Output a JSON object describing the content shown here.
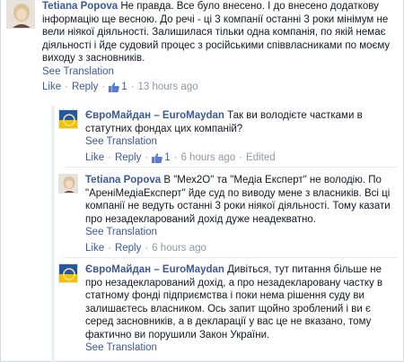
{
  "comments": [
    {
      "author": "Tetiana Popova",
      "text": "Не правда. Все було внесено. І до внесено додаткову інформацію ще весною. До речі - ці 3 компанії останні 3 роки мінімум не вели ніякої діяльності. Залишилася тільки одна компанія, по якій немає діяльності і йде судовий процес з російськими співвласниками по моєму виходу з засновників.",
      "see_translation": "See Translation",
      "actions": {
        "like": "Like",
        "reply": "Reply",
        "likes": "1",
        "time": "13 hours ago",
        "edited": ""
      }
    },
    {
      "author": "ЄвроМайдан – EuroMaydan",
      "text": "Так ви володієте частками в статутних фондах цих компаній?",
      "see_translation": "See Translation",
      "actions": {
        "like": "Like",
        "reply": "Reply",
        "likes": "1",
        "time": "6 hours ago",
        "edited": "Edited"
      }
    },
    {
      "author": "Tetiana Popova",
      "text": "В \"Мех2О\" та \"Медіа Експерт\" не володію. По \"АреніМедіаЕксперт\" йде суд по виводу мене з власників. Всі ці компанії не ведуть останні 3 роки ніякої діяльності. Тому казати про незадекларований дохід дуже неадекватно.",
      "see_translation": "See Translation",
      "actions": {
        "like": "Like",
        "reply": "Reply",
        "likes": "",
        "time": "6 hours ago",
        "edited": ""
      }
    },
    {
      "author": "ЄвроМайдан – EuroMaydan",
      "text": "Дивіться, тут питання більше не про незадекларований дохід, а про незадекларовану частку в статному фонді підприємства і поки нема рішення суду ви залишаєтесь власником. Ось запит щойно зроблений і ви є серед засновників, а в декларації у вас це не вказано, тому фактично ви порушили Закон України.",
      "see_translation": "See Translation"
    }
  ],
  "colors": {
    "link": "#3b5998",
    "meta": "#9197a3"
  }
}
